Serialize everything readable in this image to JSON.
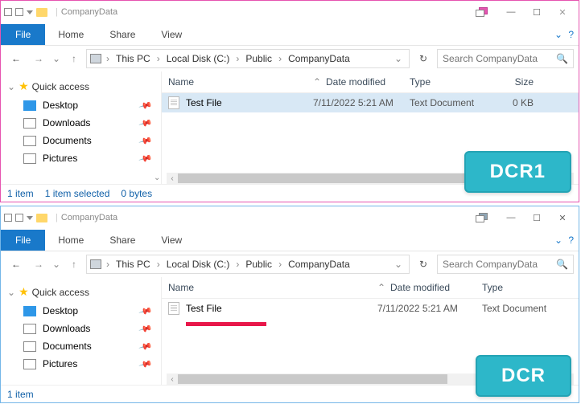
{
  "windows": [
    {
      "title": "CompanyData",
      "ribbon": {
        "file": "File",
        "tabs": [
          "Home",
          "Share",
          "View"
        ]
      },
      "breadcrumbs": [
        "This PC",
        "Local Disk (C:)",
        "Public",
        "CompanyData"
      ],
      "search_placeholder": "Search CompanyData",
      "columns": {
        "name": "Name",
        "modified": "Date modified",
        "type": "Type",
        "size": "Size"
      },
      "quick_access": {
        "label": "Quick access",
        "items": [
          "Desktop",
          "Downloads",
          "Documents",
          "Pictures"
        ]
      },
      "rows": [
        {
          "name": "Test File",
          "modified": "7/11/2022 5:21 AM",
          "type": "Text Document",
          "size": "0 KB",
          "selected": true
        }
      ],
      "status": {
        "count": "1 item",
        "selected": "1 item selected",
        "bytes": "0 bytes"
      },
      "badge": "DCR1"
    },
    {
      "title": "CompanyData",
      "ribbon": {
        "file": "File",
        "tabs": [
          "Home",
          "Share",
          "View"
        ]
      },
      "breadcrumbs": [
        "This PC",
        "Local Disk (C:)",
        "Public",
        "CompanyData"
      ],
      "search_placeholder": "Search CompanyData",
      "columns": {
        "name": "Name",
        "modified": "Date modified",
        "type": "Type"
      },
      "quick_access": {
        "label": "Quick access",
        "items": [
          "Desktop",
          "Downloads",
          "Documents",
          "Pictures"
        ]
      },
      "rows": [
        {
          "name": "Test File",
          "modified": "7/11/2022 5:21 AM",
          "type": "Text Document",
          "selected": false
        }
      ],
      "status": {
        "count": "1 item"
      },
      "badge": "DCR"
    }
  ]
}
